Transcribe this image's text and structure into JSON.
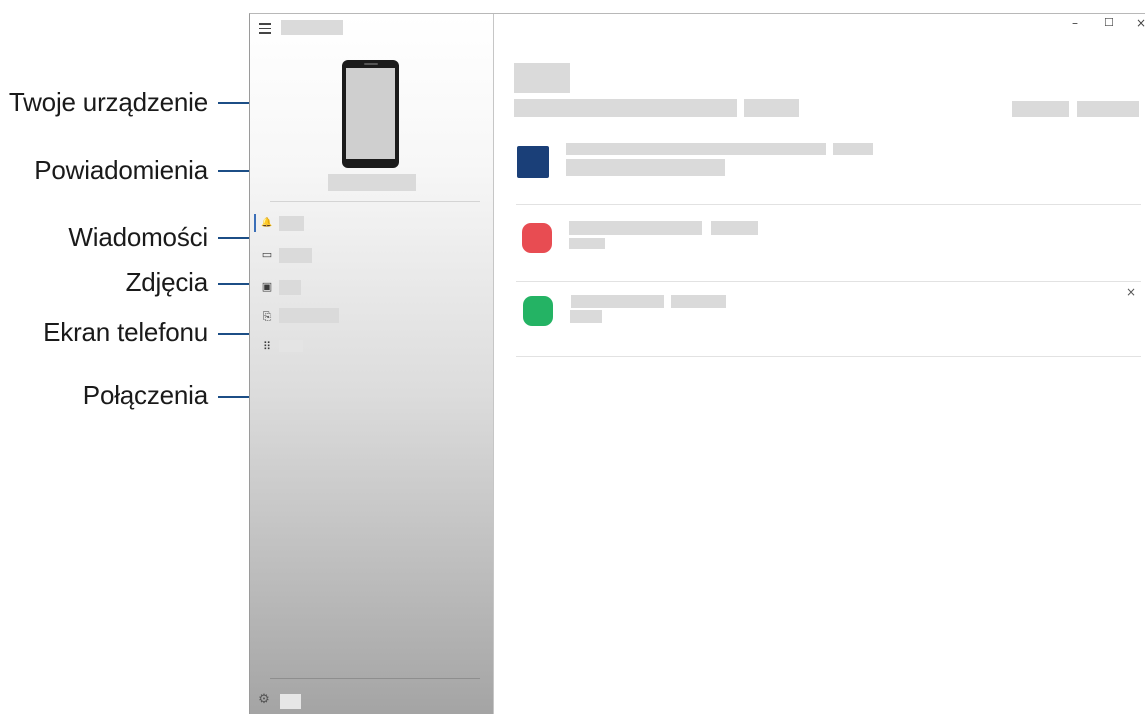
{
  "callouts": {
    "device": "Twoje urządzenie",
    "notifications": "Powiadomienia",
    "messages": "Wiadomości",
    "photos": "Zdjęcia",
    "phone_screen": "Ekran telefonu",
    "calls": "Połączenia"
  },
  "window_controls": {
    "minimize": "–",
    "maximize": "☐",
    "close": "×"
  },
  "sidebar": {
    "nav_icons": {
      "notifications": "🔔",
      "messages": "▭",
      "photos": "▣",
      "phone_screen": "⎘",
      "calls": "⠿"
    },
    "settings_icon": "⚙"
  },
  "notifications": {
    "dismiss_label": "×"
  },
  "colors": {
    "accent": "#1c4e86",
    "app_blue": "#1a3f78",
    "app_red": "#e84c52",
    "app_green": "#24b364"
  }
}
